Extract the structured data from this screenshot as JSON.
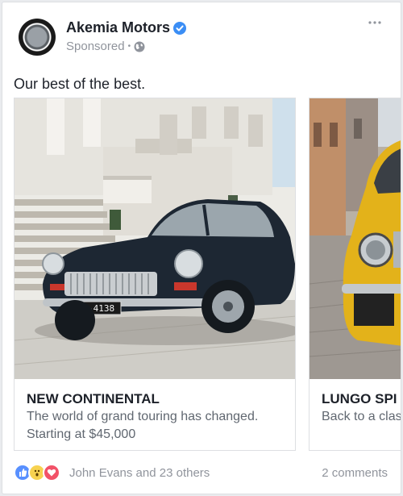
{
  "post": {
    "page_name": "Akemia Motors",
    "sponsored_label": "Sponsored",
    "separator": "•",
    "text": "Our best of the best.",
    "more_label": "•••"
  },
  "carousel": {
    "items": [
      {
        "title": "NEW CONTINENTAL",
        "description": "The world of grand touring has changed.",
        "price": "Starting at $45,000",
        "plate": "DC-4138"
      },
      {
        "title": "LUNGO SPI",
        "description": "Back to a clas"
      }
    ]
  },
  "footer": {
    "reactions_text": "John Evans and 23 others",
    "comments_text": "2 comments"
  },
  "colors": {
    "brand_blue": "#4267b2",
    "verified_blue": "#3b8ef5",
    "text_primary": "#1d2129",
    "text_secondary": "#90949c"
  },
  "icons": [
    "avatar-logo",
    "verified-badge-icon",
    "globe-icon",
    "more-options-icon",
    "like-reaction-icon",
    "wow-reaction-icon",
    "love-reaction-icon"
  ]
}
